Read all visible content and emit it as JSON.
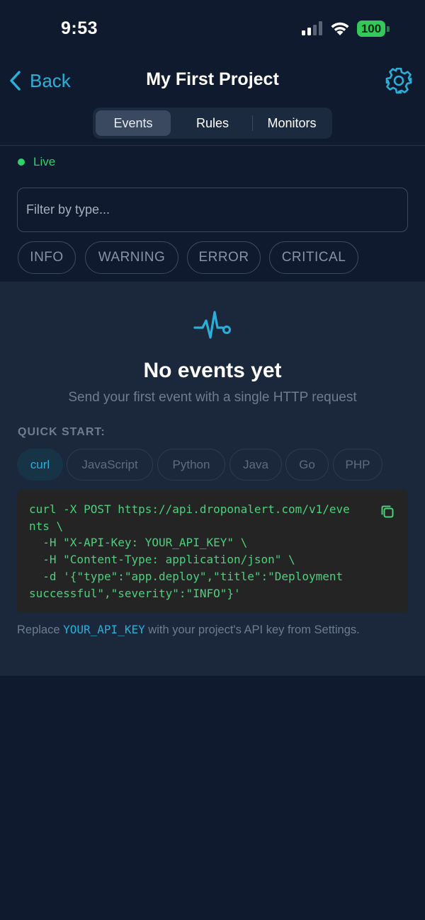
{
  "status_bar": {
    "time": "9:53",
    "battery": "100",
    "icons": [
      "signal-icon",
      "wifi-icon",
      "battery-icon"
    ]
  },
  "nav": {
    "back_label": "Back",
    "title": "My First Project",
    "settings_icon": "gear-icon"
  },
  "tabs": [
    {
      "label": "Events",
      "active": true
    },
    {
      "label": "Rules",
      "active": false
    },
    {
      "label": "Monitors",
      "active": false
    }
  ],
  "live": {
    "label": "Live",
    "color": "#2fd26a"
  },
  "filter": {
    "placeholder": "Filter by type...",
    "value": ""
  },
  "severity_chips": [
    "INFO",
    "WARNING",
    "ERROR",
    "CRITICAL"
  ],
  "empty_state": {
    "icon": "activity-pulse-icon",
    "title": "No events yet",
    "subtitle": "Send your first event with a single HTTP request"
  },
  "quick_start": {
    "label": "QUICK START:",
    "languages": [
      {
        "label": "curl",
        "active": true
      },
      {
        "label": "JavaScript",
        "active": false
      },
      {
        "label": "Python",
        "active": false
      },
      {
        "label": "Java",
        "active": false
      },
      {
        "label": "Go",
        "active": false
      },
      {
        "label": "PHP",
        "active": false
      }
    ],
    "code": "curl -X POST https://api.droponalert.com/v1/eve\nnts \\\n  -H \"X-API-Key: YOUR_API_KEY\" \\\n  -H \"Content-Type: application/json\" \\\n  -d '{\"type\":\"app.deploy\",\"title\":\"Deployment\nsuccessful\",\"severity\":\"INFO\"}'",
    "copy_icon": "copy-icon"
  },
  "note": {
    "prefix": "Replace ",
    "key": "YOUR_API_KEY",
    "suffix": " with your project's API key from Settings."
  },
  "colors": {
    "background": "#0f1a2e",
    "panel": "#1b283b",
    "accent": "#2ab0d8",
    "code_text": "#4cd07d",
    "live_green": "#2fd26a"
  }
}
